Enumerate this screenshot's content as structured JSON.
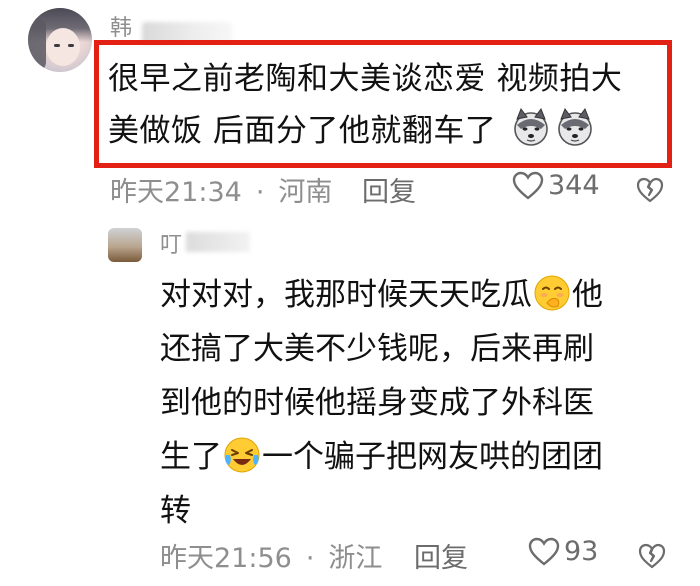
{
  "comments": [
    {
      "author": "韩",
      "text_line1": "很早之前老陶和大美谈恋爱 视频拍大",
      "text_line2": "美做饭  后面分了他就翻车了",
      "emoji": "doge-icon",
      "time": "昨天21:34",
      "separator": "·",
      "location": "河南",
      "reply_label": "回复",
      "likes": "344"
    }
  ],
  "reply": {
    "author": "叮",
    "line1_a": "对对对，我那时候天天吃瓜",
    "line1_b": "他",
    "line2": "还搞了大美不少钱呢，后来再刷",
    "line3": "到他的时候他摇身变成了外科医",
    "line4_a": "生了",
    "line4_b": "一个骗子把网友哄的团团",
    "line5": "转",
    "time": "昨天21:56",
    "separator": "·",
    "location": "浙江",
    "reply_label": "回复",
    "likes": "93"
  },
  "colors": {
    "highlight_border": "#e32014",
    "meta_text": "#8e8e8e"
  }
}
